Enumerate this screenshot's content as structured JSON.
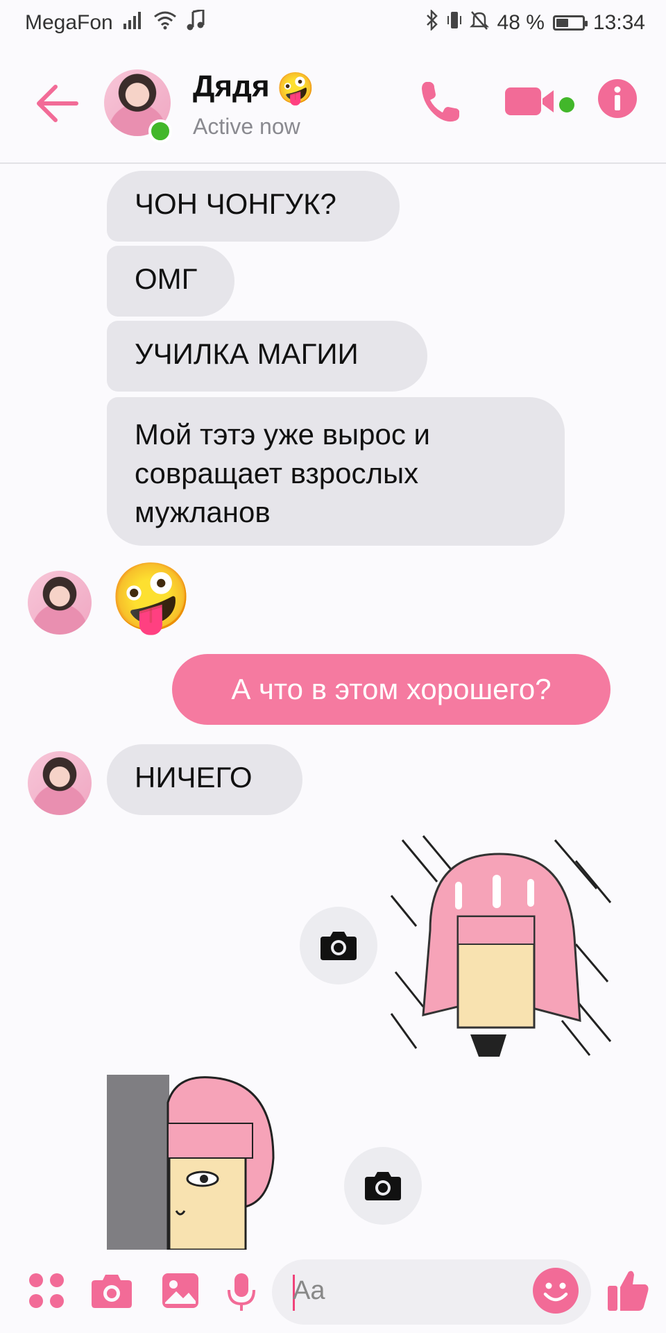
{
  "status_bar": {
    "carrier": "MegaFon",
    "battery_percent": "48 %",
    "battery_level": 0.48,
    "time": "13:34"
  },
  "header": {
    "contact_name": "Дядя",
    "contact_emoji": "🤪",
    "status": "Active now"
  },
  "messages": {
    "m1": "ЧОН ЧОНГУК?",
    "m2": "ОМГ",
    "m3": "УЧИЛКА МАГИИ",
    "m4_line1": "Мой тэтэ уже вырос и",
    "m4_line2": "совращает взрослых",
    "m4_line3": "мужланов",
    "emoji": "🤪",
    "outgoing": "А что в этом хорошего?",
    "m5": "НИЧЕГО"
  },
  "composer": {
    "placeholder": "Aa"
  },
  "colors": {
    "accent": "#f26b97",
    "outgoing_bubble": "#f57aa0",
    "incoming_bubble": "#e6e5ea",
    "online": "#42b72a"
  },
  "icons": {
    "back": "arrow-left-icon",
    "call": "phone-icon",
    "video": "video-camera-icon",
    "info": "info-icon",
    "menu": "four-dots-icon",
    "camera": "camera-icon",
    "gallery": "image-icon",
    "mic": "microphone-icon",
    "emoji": "smile-icon",
    "like": "thumbs-up-icon"
  }
}
